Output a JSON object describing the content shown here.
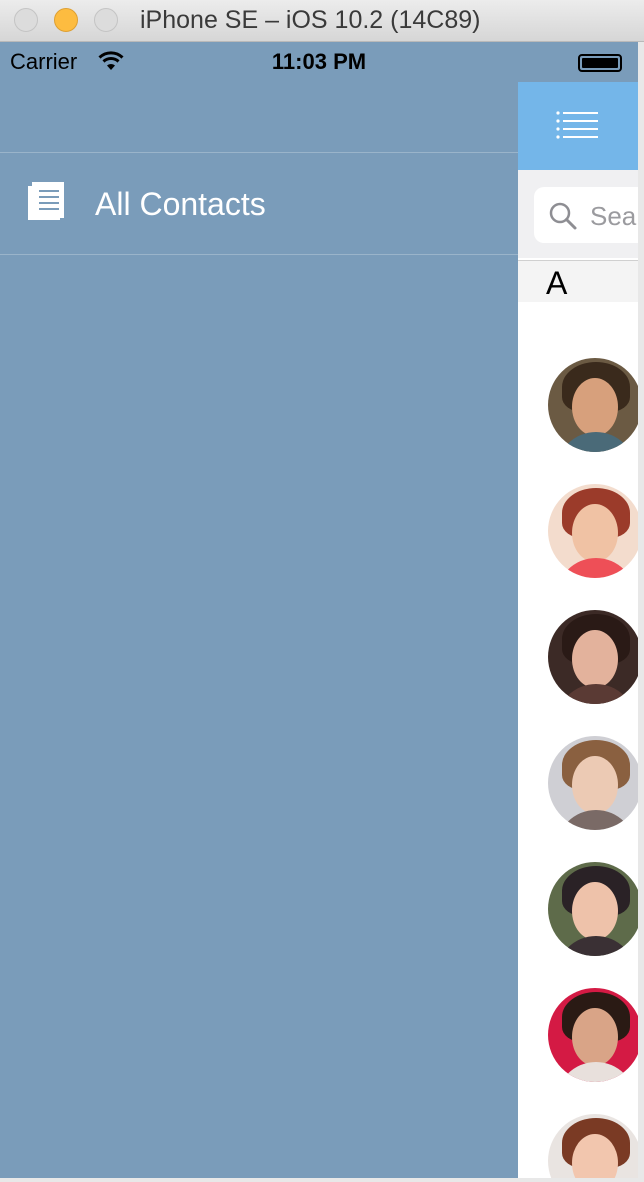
{
  "window": {
    "title": "iPhone SE – iOS 10.2 (14C89)"
  },
  "status_bar": {
    "carrier": "Carrier",
    "time": "11:03 PM",
    "icons": [
      "wifi-icon",
      "battery-icon"
    ]
  },
  "side_menu": {
    "items": [
      {
        "label": "All Contacts",
        "icon": "contacts-list-icon"
      }
    ]
  },
  "contacts_panel": {
    "menu_icon": "hamburger-menu-icon",
    "search": {
      "placeholder": "Sea",
      "icon": "search-icon"
    },
    "sections": [
      {
        "letter": "A",
        "avatar_count": 7
      }
    ]
  },
  "colors": {
    "menu_background": "#7a9cba",
    "navbar_background": "#74b6e9",
    "menu_text": "#ffffff"
  }
}
